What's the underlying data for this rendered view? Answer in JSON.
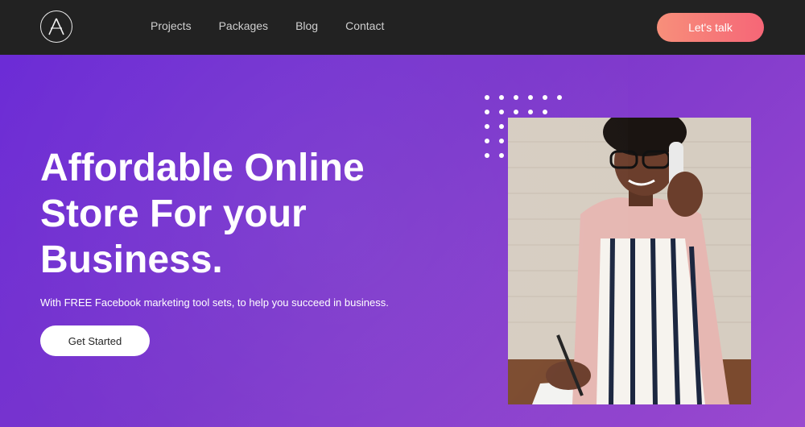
{
  "nav": {
    "links": [
      "Projects",
      "Packages",
      "Blog",
      "Contact"
    ],
    "cta_label": "Let's talk"
  },
  "hero": {
    "title": "Affordable Online Store For your Business.",
    "subtitle": "With FREE Facebook marketing tool sets, to help you succeed in business.",
    "button_label": "Get Started"
  },
  "icons": {
    "logo": "a-logo-icon"
  },
  "colors": {
    "nav_bg": "#222222",
    "hero_gradient_start": "#6c2cd6",
    "hero_gradient_end": "#9a49cf",
    "cta_gradient_start": "#f78f7a",
    "cta_gradient_end": "#f66677"
  }
}
